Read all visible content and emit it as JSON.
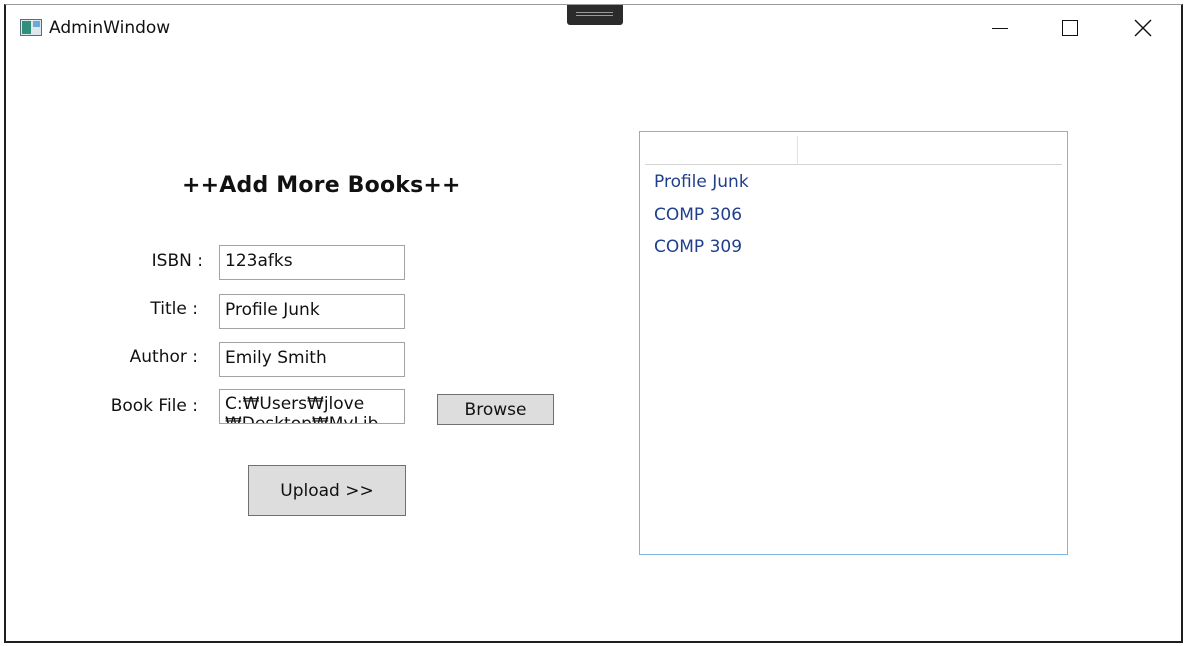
{
  "window": {
    "title": "AdminWindow"
  },
  "caption_buttons": {
    "minimize_icon": "minimize-icon",
    "maximize_icon": "maximize-icon",
    "close_icon": "close-icon",
    "close_glyph": "✕"
  },
  "form": {
    "heading": "++Add More Books++",
    "isbn_label": "ISBN :",
    "isbn_value": "123afks",
    "title_label": "Title :",
    "title_value": "Profile Junk",
    "author_label": "Author :",
    "author_value": "Emily Smith",
    "file_label": "Book File :",
    "file_value": "C:₩Users₩jlove ₩Desktop₩MyLib",
    "browse_label": "Browse",
    "upload_label": "Upload >>"
  },
  "book_list": {
    "columns": [
      "",
      ""
    ],
    "items": [
      "Profile Junk",
      "COMP 306",
      "COMP 309"
    ]
  }
}
